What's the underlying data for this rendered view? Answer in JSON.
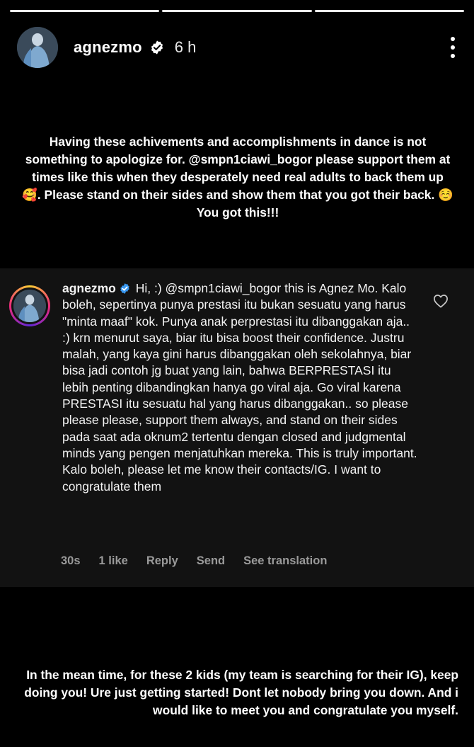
{
  "story": {
    "progress_segments": 3,
    "user": "agnezmo",
    "time_ago": "6 h"
  },
  "caption_top": "Having these achivements and accomplishments in dance is not something to apologize for. @smpn1ciawi_bogor please support them at times like this when they desperately need real adults to back them up 🥰. Please stand on their sides and show them that you got their back. ☺️You got this!!!",
  "comment": {
    "user": "agnezmo",
    "text": "Hi, :) @smpn1ciawi_bogor this is Agnez Mo. Kalo boleh, sepertinya punya prestasi itu bukan sesuatu yang harus \"minta maaf\" kok. Punya anak perprestasi itu dibanggakan aja.. :) krn menurut saya, biar itu bisa boost their confidence. Justru malah, yang kaya gini harus dibanggakan oleh sekolahnya, biar bisa jadi contoh jg buat yang lain, bahwa BERPRESTASI itu lebih penting dibandingkan hanya go viral aja. Go viral karena PRESTASI itu sesuatu hal yang harus dibanggakan.. so please please please, support them always, and stand on their sides pada saat ada oknum2 tertentu dengan closed and judgmental minds yang pengen menjatuhkan mereka. This is truly important. Kalo boleh, please let me know their contacts/IG. I want to congratulate them",
    "time": "30s",
    "likes": "1 like",
    "reply_label": "Reply",
    "send_label": "Send",
    "translate_label": "See translation"
  },
  "caption_bottom": "In the mean time, for these 2 kids (my team is searching for their IG), keep doing you! Ure just getting started! Dont let nobody bring you down. And i would like to meet you and congratulate you myself.",
  "colors": {
    "background": "#000000",
    "comment_card": "#121212",
    "verified_badge": "#ffffff",
    "comment_verified": "#3897f0",
    "meta_text": "#9a9a9a"
  },
  "icons": {
    "verified": "verified-badge-icon",
    "more": "more-vertical-icon",
    "like": "heart-outline-icon"
  }
}
